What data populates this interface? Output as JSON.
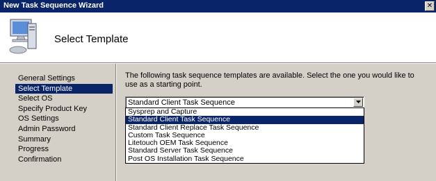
{
  "window": {
    "title": "New Task Sequence Wizard",
    "close_label": "✕"
  },
  "header": {
    "title": "Select Template"
  },
  "steps": [
    "General Settings",
    "Select Template",
    "Select OS",
    "Specify Product Key",
    "OS Settings",
    "Admin Password",
    "Summary",
    "Progress",
    "Confirmation"
  ],
  "active_step_index": 1,
  "description": "The following task sequence templates are available.  Select the one you would like to use as a starting point.",
  "template_select": {
    "value": "Standard Client Task Sequence",
    "options": [
      "Sysprep and Capture",
      "Standard Client Task Sequence",
      "Standard Client Replace Task Sequence",
      "Custom Task Sequence",
      "Litetouch OEM Task Sequence",
      "Standard Server Task Sequence",
      "Post OS Installation Task Sequence"
    ],
    "highlighted_index": 1
  },
  "colors": {
    "accent": "#0a246a",
    "face": "#d4d0c8",
    "header_bg": "#ffffff"
  }
}
